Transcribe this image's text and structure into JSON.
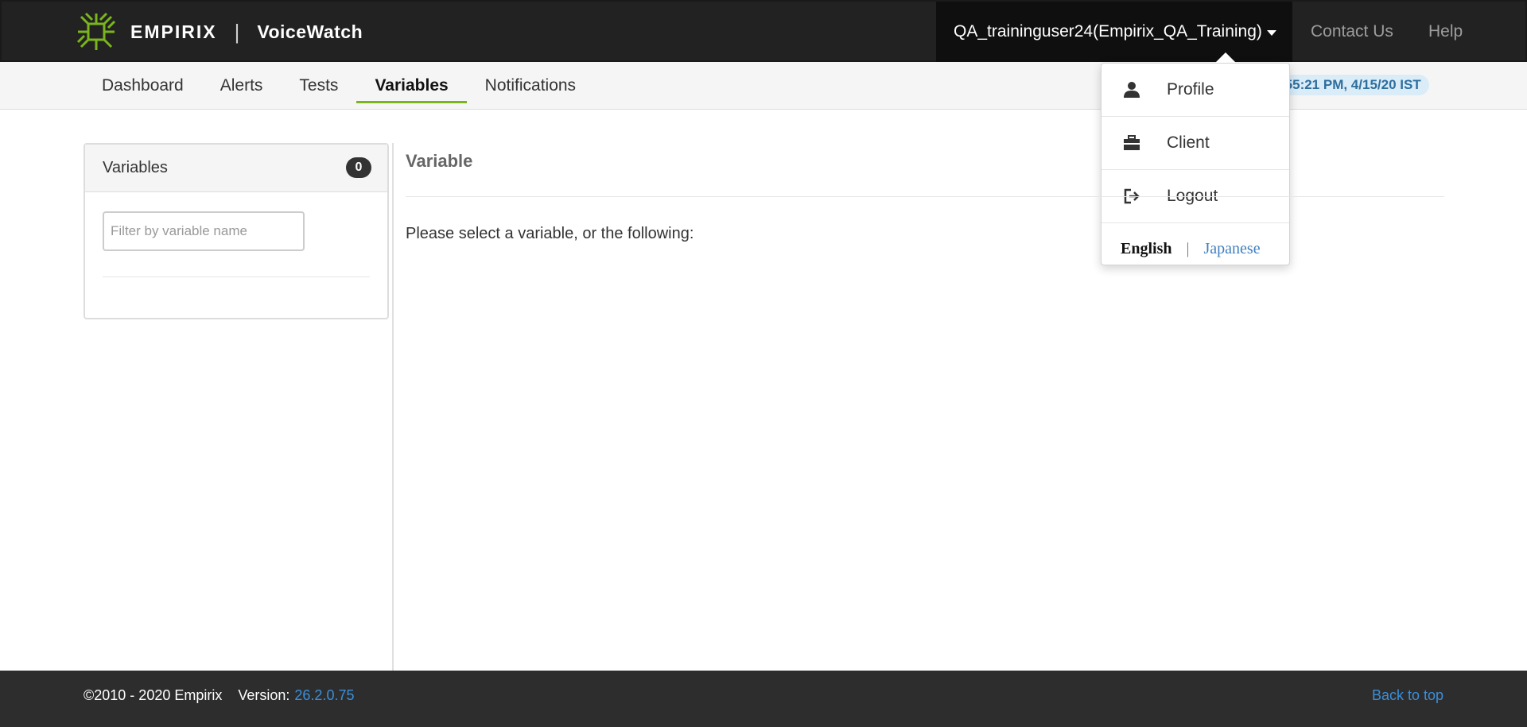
{
  "header": {
    "brand_name": "EMPIRIX",
    "brand_separator": "|",
    "product_name": "VoiceWatch",
    "user_menu_label": "QA_traininguser24(Empirix_QA_Training)",
    "contact_label": "Contact Us",
    "help_label": "Help"
  },
  "nav": {
    "tabs": [
      {
        "label": "Dashboard"
      },
      {
        "label": "Alerts"
      },
      {
        "label": "Tests"
      },
      {
        "label": "Variables",
        "active": true
      },
      {
        "label": "Notifications"
      }
    ],
    "clock_text": ":55:21 PM, 4/15/20 IST"
  },
  "dropdown": {
    "items": [
      {
        "label": "Profile",
        "icon": "user-icon"
      },
      {
        "label": "Client",
        "icon": "briefcase-icon"
      },
      {
        "label": "Logout",
        "icon": "logout-icon"
      }
    ],
    "lang_english": "English",
    "lang_separator": "|",
    "lang_japanese": "Japanese"
  },
  "variables_panel": {
    "title": "Variables",
    "count": "0",
    "filter_placeholder": "Filter by variable name"
  },
  "main": {
    "title": "Variable",
    "message": "Please select a variable, or the following:"
  },
  "footer": {
    "copyright": "©2010 - 2020 Empirix",
    "version_label": "Version:",
    "version": "26.2.0.75",
    "back_to_top": "Back to top"
  },
  "colors": {
    "accent_green": "#7ab51d",
    "link_blue": "#3b8fd9",
    "topbar": "#222222"
  }
}
